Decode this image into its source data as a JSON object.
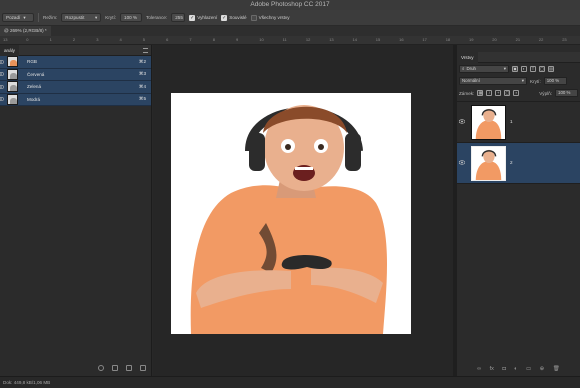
{
  "app": {
    "title": "Adobe Photoshop CC 2017"
  },
  "options": {
    "tool_preset": "Pozadí",
    "mode_label": "Režim:",
    "mode_value": "Rozpustit",
    "opacity_label": "Krytí:",
    "opacity_value": "100 %",
    "tolerance_label": "Tolerance:",
    "tolerance_value": "255",
    "antialias_label": "Vyhlazení",
    "antialias_checked": true,
    "contiguous_label": "Souvislé",
    "contiguous_checked": true,
    "all_layers_label": "Všechny vrstvy",
    "all_layers_checked": false
  },
  "document": {
    "tab_label": "@ 269% (2,RGB/8) *"
  },
  "ruler": {
    "labels": [
      "13",
      "0",
      "1",
      "2",
      "3",
      "4",
      "5",
      "6",
      "7",
      "8",
      "9",
      "10",
      "11",
      "12",
      "13",
      "14",
      "15",
      "16",
      "17",
      "18",
      "19",
      "20",
      "21",
      "22",
      "23"
    ]
  },
  "channels_panel": {
    "title": "anály",
    "channels": [
      {
        "name": "RGB",
        "shortcut": "⌘2"
      },
      {
        "name": "Červená",
        "shortcut": "⌘3"
      },
      {
        "name": "Zelená",
        "shortcut": "⌘4"
      },
      {
        "name": "Modrá",
        "shortcut": "⌘5"
      }
    ]
  },
  "layers_panel": {
    "title": "Vrstvy",
    "filter_label": "Druh",
    "blend_mode": "Normální",
    "opacity_label": "Krytí:",
    "opacity_value": "100 %",
    "lock_label": "Zámek:",
    "fill_label": "Výplň:",
    "fill_value": "100 %",
    "layers": [
      {
        "name": "1",
        "selected": false
      },
      {
        "name": "2",
        "selected": true
      }
    ],
    "footer_icons": [
      "link-icon",
      "fx-icon",
      "mask-icon",
      "adjustment-icon",
      "group-icon",
      "new-layer-icon",
      "trash-icon"
    ],
    "footer_glyphs": [
      "∞",
      "fx",
      "◘",
      "◐",
      "▭",
      "⊕",
      "🗑"
    ]
  },
  "status": {
    "text": "Dok: 449,8 kB/1,06 MB"
  },
  "colors": {
    "selection_blue": "#2b4462",
    "shirt_orange": "#f29a64",
    "skin": "#e9b08e",
    "headphones": "#2c2c2c"
  }
}
